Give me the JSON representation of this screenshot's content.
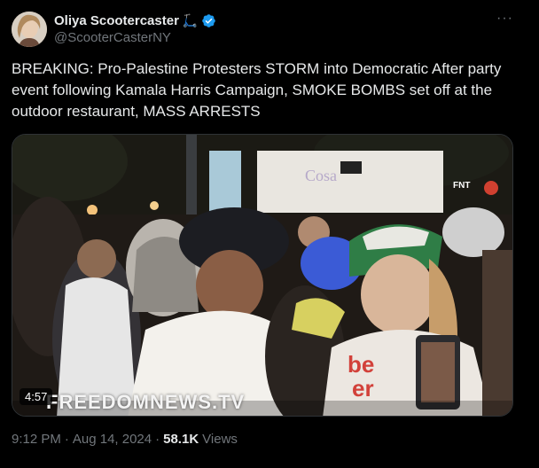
{
  "author": {
    "display_name": "Oliya Scootercaster",
    "emoji": "🛴",
    "handle": "@ScooterCasterNY",
    "verified": true
  },
  "tweet": {
    "text": "BREAKING: Pro-Palestine Protesters STORM into Democratic After party event following Kamala Harris Campaign, SMOKE BOMBS set off at the outdoor restaurant, MASS ARRESTS"
  },
  "media": {
    "duration": "4:57",
    "watermark": "FREEDOMNEWS.TV",
    "badge": "FNT"
  },
  "meta": {
    "time": "9:12 PM",
    "separator": "·",
    "date": "Aug 14, 2024",
    "views_count": "58.1K",
    "views_label": "Views"
  },
  "colors": {
    "background": "#000000",
    "text_primary": "#e7e9ea",
    "text_secondary": "#71767b",
    "verified_blue": "#1d9bf0",
    "border": "#2f3336"
  },
  "icons": {
    "verified": "verified-badge-icon",
    "more": "more-options-icon"
  }
}
